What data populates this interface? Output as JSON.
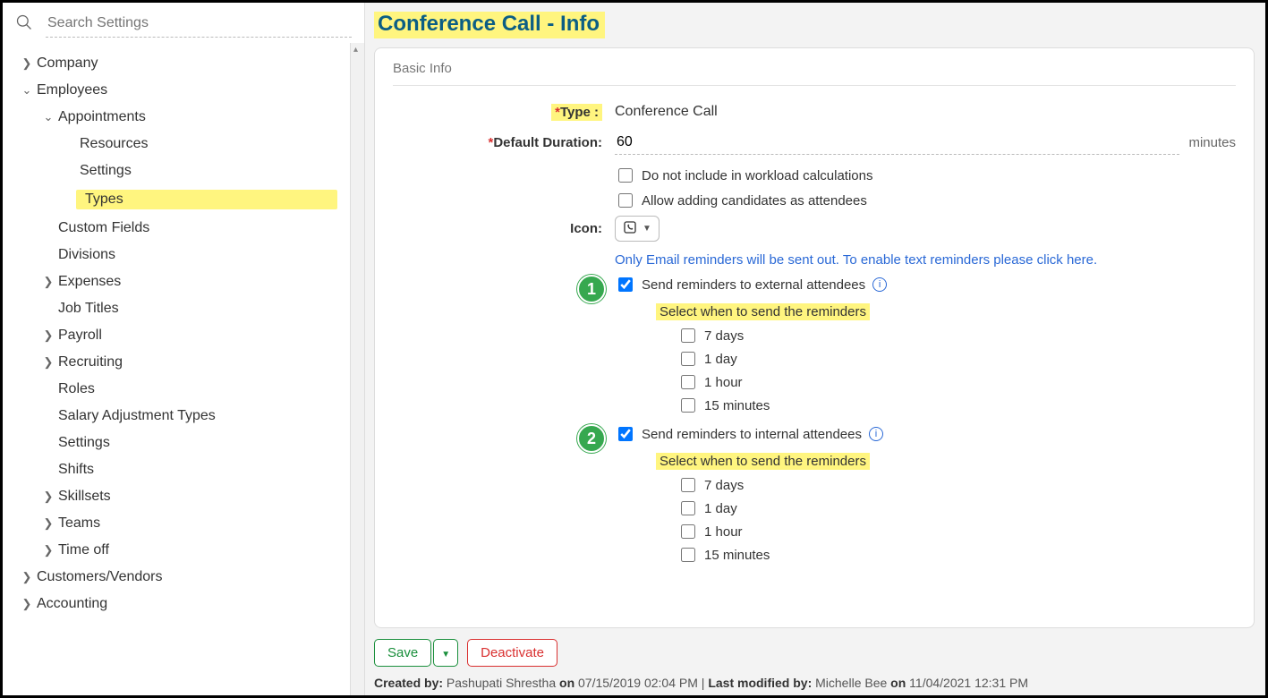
{
  "search": {
    "placeholder": "Search Settings"
  },
  "nav": {
    "company": "Company",
    "employees": "Employees",
    "appointments": "Appointments",
    "resources": "Resources",
    "settings_a": "Settings",
    "types": "Types",
    "custom_fields": "Custom Fields",
    "divisions": "Divisions",
    "expenses": "Expenses",
    "job_titles": "Job Titles",
    "payroll": "Payroll",
    "recruiting": "Recruiting",
    "roles": "Roles",
    "salary_adj": "Salary Adjustment Types",
    "settings_e": "Settings",
    "shifts": "Shifts",
    "skillsets": "Skillsets",
    "teams": "Teams",
    "time_off": "Time off",
    "customers": "Customers/Vendors",
    "accounting": "Accounting"
  },
  "page": {
    "title": "Conference Call - Info"
  },
  "section": {
    "basic_info": "Basic Info"
  },
  "form": {
    "type_label": "Type :",
    "type_value": "Conference Call",
    "duration_label": "Default Duration:",
    "duration_value": "60",
    "duration_unit": "minutes",
    "workload": "Do not include in workload calculations",
    "candidates": "Allow adding candidates as attendees",
    "icon_label": "Icon:",
    "reminder_notice": "Only Email reminders will be sent out. To enable text reminders please click here.",
    "external_label": "Send reminders to external attendees",
    "internal_label": "Send reminders to internal attendees",
    "select_hint": "Select when to send the reminders",
    "opts": {
      "d7": "7 days",
      "d1": "1 day",
      "h1": "1 hour",
      "m15": "15 minutes"
    }
  },
  "badges": {
    "one": "1",
    "two": "2"
  },
  "actions": {
    "save": "Save",
    "deactivate": "Deactivate"
  },
  "meta": {
    "created_by_lbl": "Created by:",
    "created_by": "Pashupati Shrestha",
    "on1": "on",
    "created_at": "07/15/2019 02:04 PM",
    "sep": " | ",
    "modified_by_lbl": "Last modified by:",
    "modified_by": "Michelle Bee",
    "on2": "on",
    "modified_at": "11/04/2021 12:31 PM"
  }
}
